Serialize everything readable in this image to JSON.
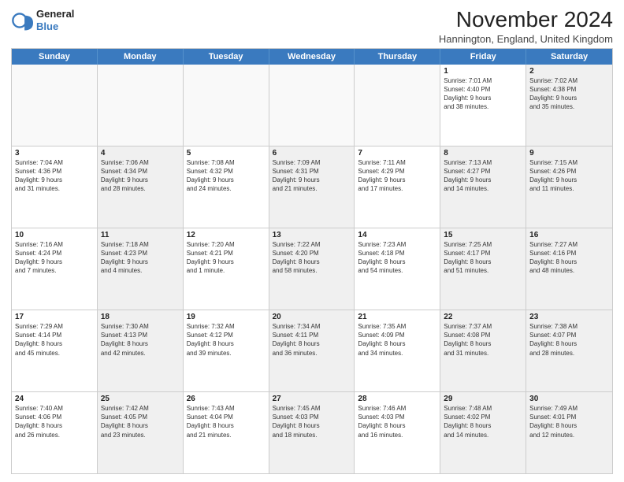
{
  "logo": {
    "general": "General",
    "blue": "Blue"
  },
  "title": "November 2024",
  "location": "Hannington, England, United Kingdom",
  "days": [
    "Sunday",
    "Monday",
    "Tuesday",
    "Wednesday",
    "Thursday",
    "Friday",
    "Saturday"
  ],
  "weeks": [
    [
      {
        "day": "",
        "empty": true
      },
      {
        "day": "",
        "empty": true
      },
      {
        "day": "",
        "empty": true
      },
      {
        "day": "",
        "empty": true
      },
      {
        "day": "",
        "empty": true
      },
      {
        "day": "1",
        "info": "Sunrise: 7:01 AM\nSunset: 4:40 PM\nDaylight: 9 hours\nand 38 minutes."
      },
      {
        "day": "2",
        "info": "Sunrise: 7:02 AM\nSunset: 4:38 PM\nDaylight: 9 hours\nand 35 minutes.",
        "shaded": true
      }
    ],
    [
      {
        "day": "3",
        "info": "Sunrise: 7:04 AM\nSunset: 4:36 PM\nDaylight: 9 hours\nand 31 minutes."
      },
      {
        "day": "4",
        "info": "Sunrise: 7:06 AM\nSunset: 4:34 PM\nDaylight: 9 hours\nand 28 minutes.",
        "shaded": true
      },
      {
        "day": "5",
        "info": "Sunrise: 7:08 AM\nSunset: 4:32 PM\nDaylight: 9 hours\nand 24 minutes."
      },
      {
        "day": "6",
        "info": "Sunrise: 7:09 AM\nSunset: 4:31 PM\nDaylight: 9 hours\nand 21 minutes.",
        "shaded": true
      },
      {
        "day": "7",
        "info": "Sunrise: 7:11 AM\nSunset: 4:29 PM\nDaylight: 9 hours\nand 17 minutes."
      },
      {
        "day": "8",
        "info": "Sunrise: 7:13 AM\nSunset: 4:27 PM\nDaylight: 9 hours\nand 14 minutes.",
        "shaded": true
      },
      {
        "day": "9",
        "info": "Sunrise: 7:15 AM\nSunset: 4:26 PM\nDaylight: 9 hours\nand 11 minutes.",
        "shaded": true
      }
    ],
    [
      {
        "day": "10",
        "info": "Sunrise: 7:16 AM\nSunset: 4:24 PM\nDaylight: 9 hours\nand 7 minutes."
      },
      {
        "day": "11",
        "info": "Sunrise: 7:18 AM\nSunset: 4:23 PM\nDaylight: 9 hours\nand 4 minutes.",
        "shaded": true
      },
      {
        "day": "12",
        "info": "Sunrise: 7:20 AM\nSunset: 4:21 PM\nDaylight: 9 hours\nand 1 minute."
      },
      {
        "day": "13",
        "info": "Sunrise: 7:22 AM\nSunset: 4:20 PM\nDaylight: 8 hours\nand 58 minutes.",
        "shaded": true
      },
      {
        "day": "14",
        "info": "Sunrise: 7:23 AM\nSunset: 4:18 PM\nDaylight: 8 hours\nand 54 minutes."
      },
      {
        "day": "15",
        "info": "Sunrise: 7:25 AM\nSunset: 4:17 PM\nDaylight: 8 hours\nand 51 minutes.",
        "shaded": true
      },
      {
        "day": "16",
        "info": "Sunrise: 7:27 AM\nSunset: 4:16 PM\nDaylight: 8 hours\nand 48 minutes.",
        "shaded": true
      }
    ],
    [
      {
        "day": "17",
        "info": "Sunrise: 7:29 AM\nSunset: 4:14 PM\nDaylight: 8 hours\nand 45 minutes."
      },
      {
        "day": "18",
        "info": "Sunrise: 7:30 AM\nSunset: 4:13 PM\nDaylight: 8 hours\nand 42 minutes.",
        "shaded": true
      },
      {
        "day": "19",
        "info": "Sunrise: 7:32 AM\nSunset: 4:12 PM\nDaylight: 8 hours\nand 39 minutes."
      },
      {
        "day": "20",
        "info": "Sunrise: 7:34 AM\nSunset: 4:11 PM\nDaylight: 8 hours\nand 36 minutes.",
        "shaded": true
      },
      {
        "day": "21",
        "info": "Sunrise: 7:35 AM\nSunset: 4:09 PM\nDaylight: 8 hours\nand 34 minutes."
      },
      {
        "day": "22",
        "info": "Sunrise: 7:37 AM\nSunset: 4:08 PM\nDaylight: 8 hours\nand 31 minutes.",
        "shaded": true
      },
      {
        "day": "23",
        "info": "Sunrise: 7:38 AM\nSunset: 4:07 PM\nDaylight: 8 hours\nand 28 minutes.",
        "shaded": true
      }
    ],
    [
      {
        "day": "24",
        "info": "Sunrise: 7:40 AM\nSunset: 4:06 PM\nDaylight: 8 hours\nand 26 minutes."
      },
      {
        "day": "25",
        "info": "Sunrise: 7:42 AM\nSunset: 4:05 PM\nDaylight: 8 hours\nand 23 minutes.",
        "shaded": true
      },
      {
        "day": "26",
        "info": "Sunrise: 7:43 AM\nSunset: 4:04 PM\nDaylight: 8 hours\nand 21 minutes."
      },
      {
        "day": "27",
        "info": "Sunrise: 7:45 AM\nSunset: 4:03 PM\nDaylight: 8 hours\nand 18 minutes.",
        "shaded": true
      },
      {
        "day": "28",
        "info": "Sunrise: 7:46 AM\nSunset: 4:03 PM\nDaylight: 8 hours\nand 16 minutes."
      },
      {
        "day": "29",
        "info": "Sunrise: 7:48 AM\nSunset: 4:02 PM\nDaylight: 8 hours\nand 14 minutes.",
        "shaded": true
      },
      {
        "day": "30",
        "info": "Sunrise: 7:49 AM\nSunset: 4:01 PM\nDaylight: 8 hours\nand 12 minutes.",
        "shaded": true
      }
    ]
  ]
}
